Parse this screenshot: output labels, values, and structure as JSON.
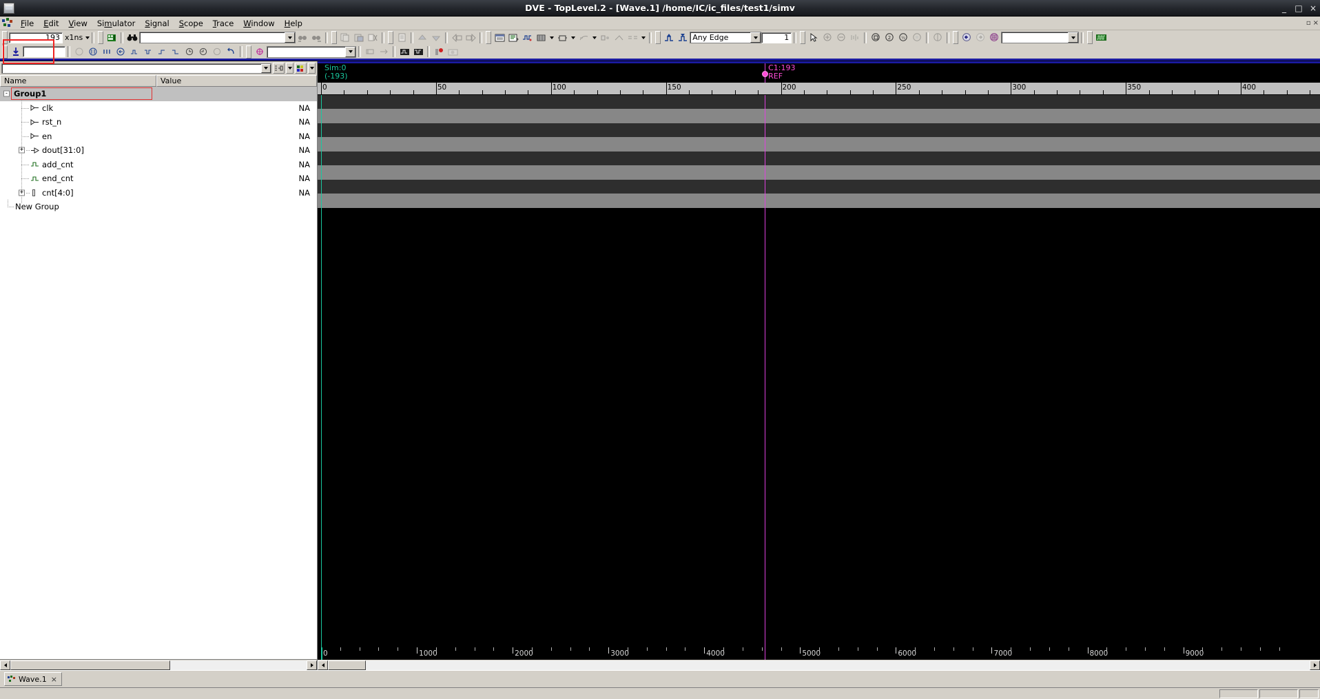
{
  "window": {
    "title": "DVE - TopLevel.2 - [Wave.1]  /home/IC/ic_files/test1/simv",
    "icon": "app-window-icon",
    "minimize": "_",
    "maximize": "□",
    "close": "×",
    "inner_restore": "▫",
    "inner_close": "×"
  },
  "menubar": {
    "items": [
      {
        "label": "File",
        "mnemonic": "F"
      },
      {
        "label": "Edit",
        "mnemonic": "E"
      },
      {
        "label": "View",
        "mnemonic": "V"
      },
      {
        "label": "Simulator",
        "mnemonic": "m"
      },
      {
        "label": "Signal",
        "mnemonic": "S"
      },
      {
        "label": "Scope",
        "mnemonic": "S"
      },
      {
        "label": "Trace",
        "mnemonic": "T"
      },
      {
        "label": "Window",
        "mnemonic": "W"
      },
      {
        "label": "Help",
        "mnemonic": "H"
      }
    ]
  },
  "toolbar_main": {
    "time_value": "193",
    "time_unit": "x1ns",
    "search_value": "",
    "edge_mode": "Any Edge",
    "edge_count": "1",
    "zoom_combo_value": "",
    "icons": [
      "goto-time-icon",
      "time-unit-icon",
      "find-signal-icon",
      "binoculars-icon",
      "binoculars-next-icon",
      "search-prev-icon",
      "search-next-icon",
      "copy-icon",
      "paste-icon",
      "cut-icon",
      "page-icon",
      "up-icon",
      "down-icon",
      "prev-view-icon",
      "next-view-icon",
      "list-view-icon",
      "source-view-icon",
      "wave-view-icon",
      "schematic-icon",
      "memory-icon",
      "hier-icon",
      "assertion-icon",
      "edge-prev-icon",
      "edge-next-icon",
      "select-tool-icon",
      "zoom-in-icon",
      "zoom-out-icon",
      "zoom-fit-icon",
      "zoom-window-icon",
      "zoom-full-icon",
      "zoom-half-icon",
      "zoom-cursor-icon",
      "pan-icon",
      "back-icon",
      "forward-icon",
      "grid-icon",
      "waveform-icon"
    ]
  },
  "toolbar_second": {
    "step_value": "",
    "annotation_value": "",
    "icons": [
      "run-icon",
      "step-icon",
      "continue-icon",
      "restart-icon",
      "break0-icon",
      "break1-icon",
      "break2-icon",
      "break3-icon",
      "undo-icon",
      "redo-icon",
      "reload-icon",
      "revert-icon",
      "add-marker-icon",
      "marker-field-icon",
      "bus-expand-icon",
      "bus-collapse-icon",
      "record-icon",
      "snapshot-icon"
    ]
  },
  "signal_pane": {
    "filter_value": "",
    "filter_btn_1": "group-icon",
    "filter_btn_2": "color-icon",
    "columns": [
      "Name",
      "Value"
    ],
    "rows": [
      {
        "name": "Group1",
        "value": "",
        "type": "group",
        "expander": "-",
        "icon": "",
        "indent": 0,
        "selected": true
      },
      {
        "name": "clk",
        "value": "NA",
        "type": "signal",
        "expander": "",
        "icon": "input-port-icon",
        "indent": 1
      },
      {
        "name": "rst_n",
        "value": "NA",
        "type": "signal",
        "expander": "",
        "icon": "input-port-icon",
        "indent": 1
      },
      {
        "name": "en",
        "value": "NA",
        "type": "signal",
        "expander": "",
        "icon": "input-port-icon",
        "indent": 1
      },
      {
        "name": "dout[31:0]",
        "value": "NA",
        "type": "bus",
        "expander": "+",
        "icon": "output-port-icon",
        "indent": 1
      },
      {
        "name": "add_cnt",
        "value": "NA",
        "type": "wire",
        "expander": "",
        "icon": "wire-icon",
        "indent": 1
      },
      {
        "name": "end_cnt",
        "value": "NA",
        "type": "wire",
        "expander": "",
        "icon": "wire-icon",
        "indent": 1
      },
      {
        "name": "cnt[4:0]",
        "value": "NA",
        "type": "bus",
        "expander": "+",
        "icon": "reg-icon",
        "indent": 1
      },
      {
        "name": "New Group",
        "value": "",
        "type": "newgroup",
        "expander": "",
        "icon": "",
        "indent": 0
      }
    ]
  },
  "wave_pane": {
    "sim_label": "Sim:0",
    "sim_offset": "(-193)",
    "cursor_name": "C1:193",
    "cursor_ref": "REF",
    "cursor_time": 193,
    "top_ruler": {
      "labels": [
        "0",
        "50",
        "100",
        "150",
        "200",
        "250",
        "300",
        "350",
        "400"
      ],
      "values": [
        0,
        50,
        100,
        150,
        200,
        250,
        300,
        350,
        400
      ],
      "minor_step": 10
    },
    "bottom_ruler": {
      "labels": [
        "0",
        "1000",
        "2000",
        "3000",
        "4000",
        "5000",
        "6000",
        "7000",
        "8000",
        "9000"
      ],
      "values": [
        0,
        1000,
        2000,
        3000,
        4000,
        5000,
        6000,
        7000,
        8000,
        9000
      ],
      "minor_step": 200
    }
  },
  "tabbar": {
    "tabs": [
      {
        "label": "Wave.1",
        "close": "×",
        "icon": "wave-tab-icon"
      }
    ]
  },
  "colors": {
    "accent_cursor": "#e040e0",
    "sim_green": "#19c9a0",
    "annotation_red": "#ee2222",
    "panel_bg": "#d4d0c8",
    "wave_bg": "#000000",
    "wave_row_dark": "#2e2e2e",
    "wave_row_light": "#878787",
    "title_bar": "#23262b",
    "separator_blue": "#1a1a9e"
  }
}
